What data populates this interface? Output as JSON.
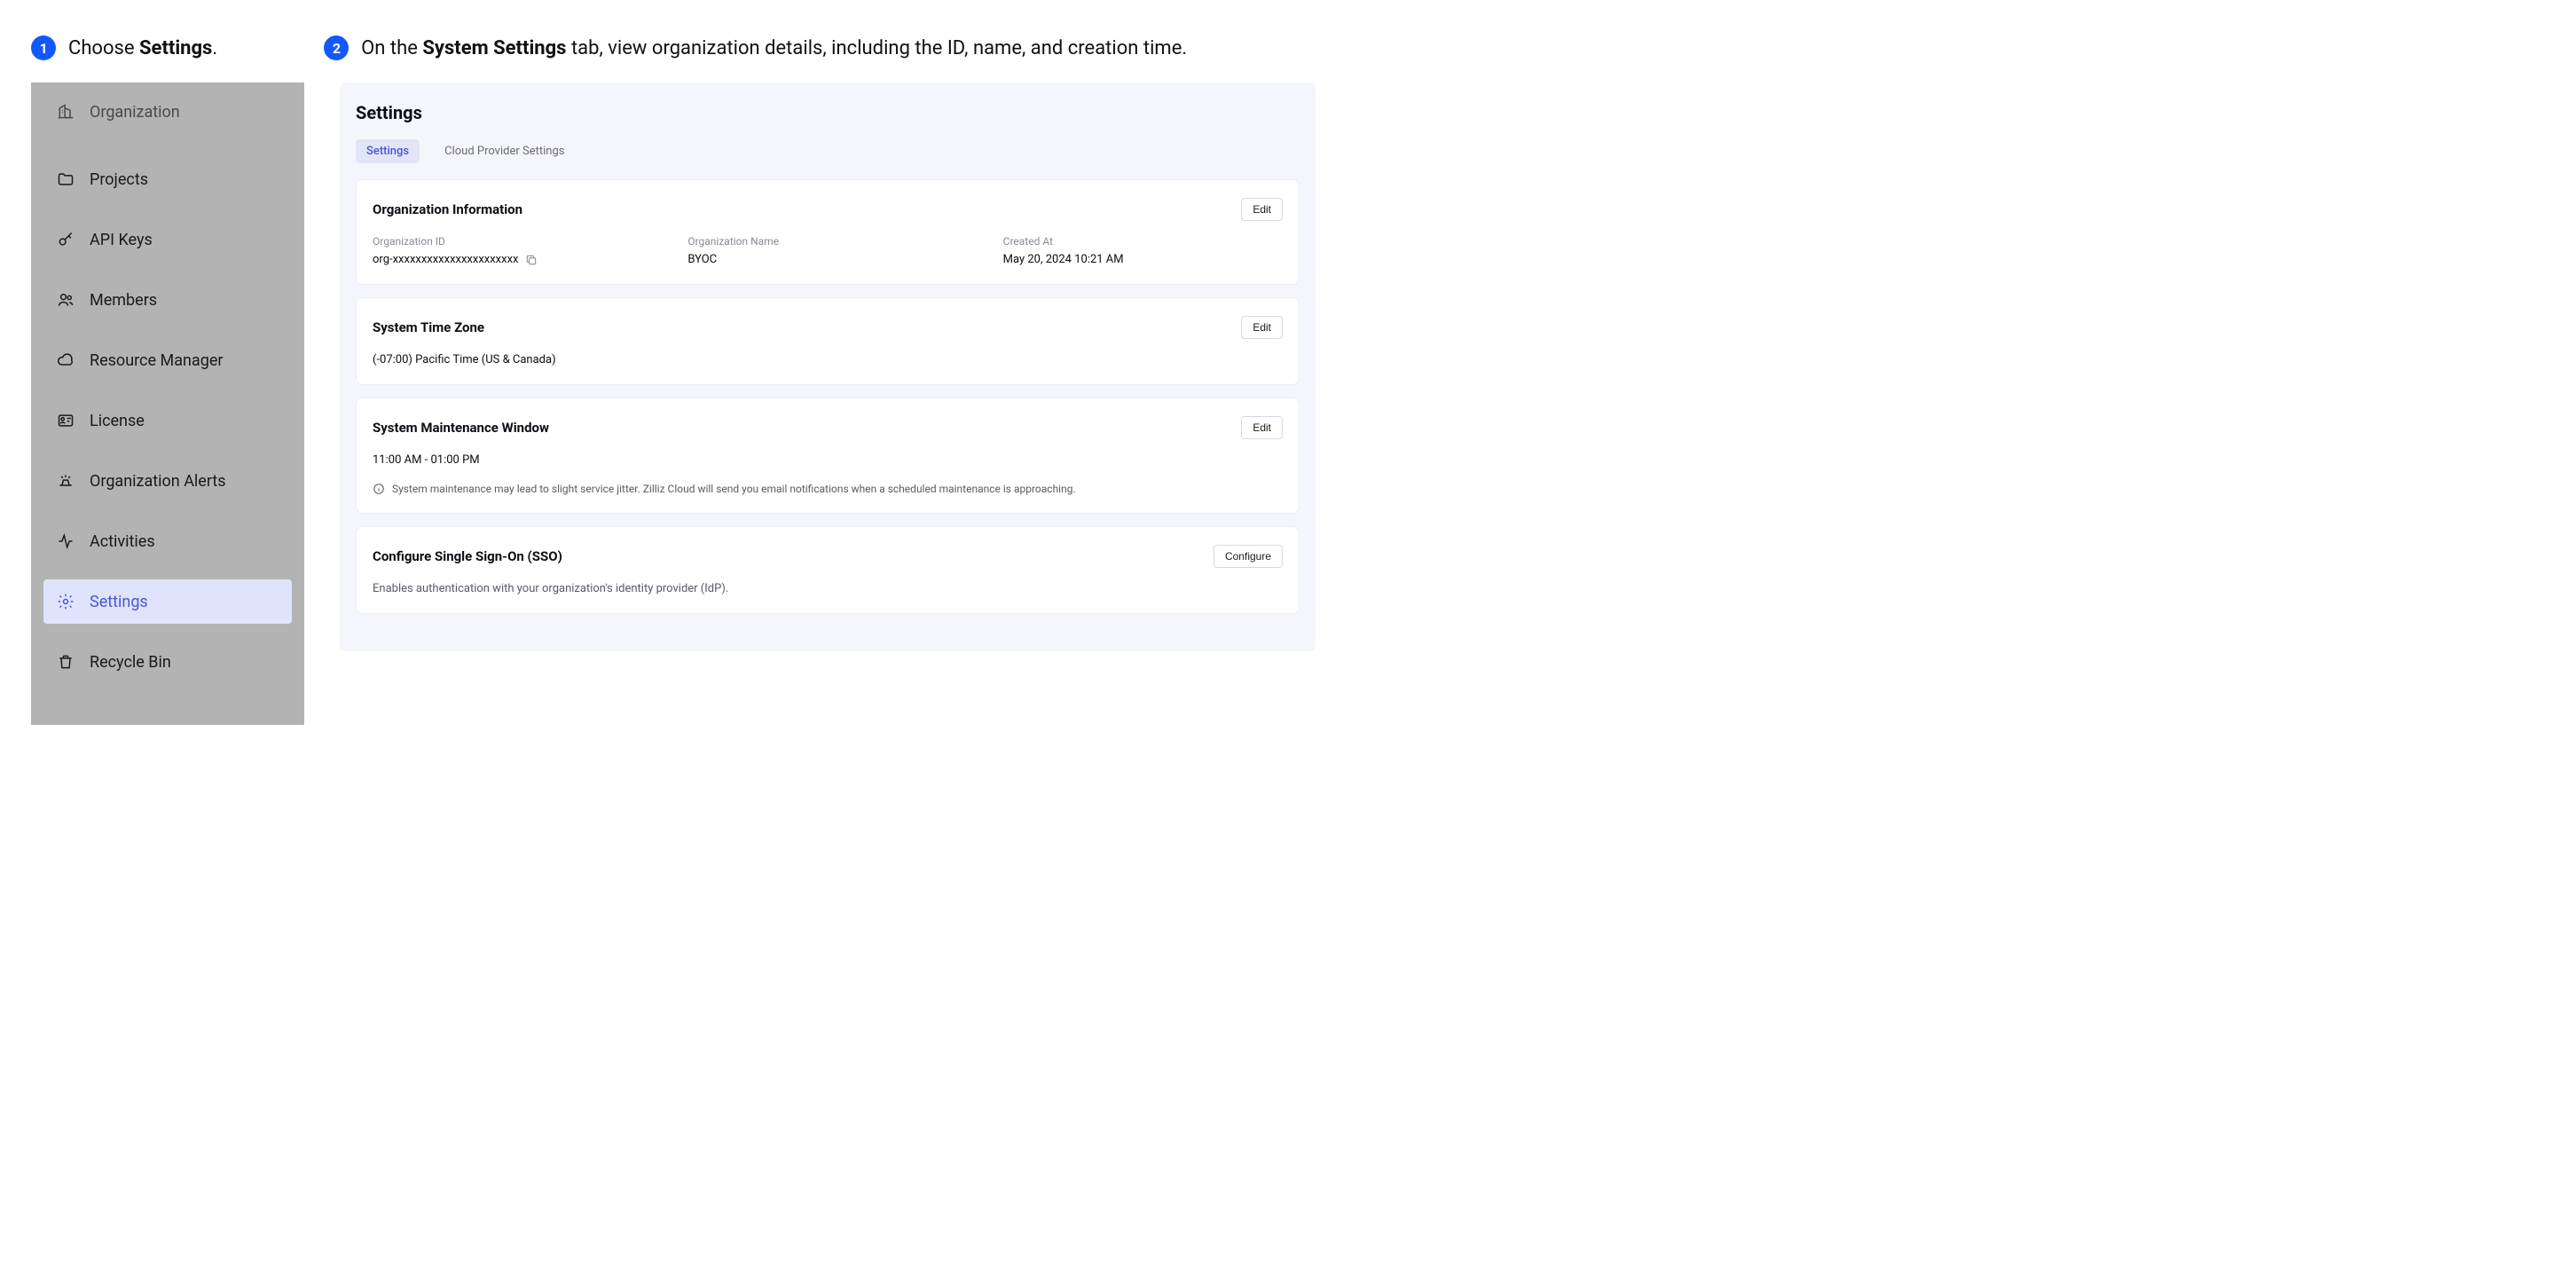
{
  "annotations": {
    "step1_prefix": "Choose ",
    "step1_bold": "Settings",
    "step1_suffix": ".",
    "step2_prefix": "On the ",
    "step2_bold": "System Settings",
    "step2_suffix": " tab, view organization details, including the ID, name, and creation time.",
    "badge1": "1",
    "badge2": "2"
  },
  "sidebar": {
    "organization": "Organization",
    "projects": "Projects",
    "api_keys": "API Keys",
    "members": "Members",
    "resource_manager": "Resource Manager",
    "license": "License",
    "alerts": "Organization Alerts",
    "activities": "Activities",
    "settings": "Settings",
    "recycle_bin": "Recycle Bin"
  },
  "main": {
    "title": "Settings",
    "tabs": {
      "settings": "Settings",
      "cloud_provider": "Cloud Provider Settings"
    },
    "org_info": {
      "title": "Organization Information",
      "edit": "Edit",
      "id_label": "Organization ID",
      "id_value": "org-xxxxxxxxxxxxxxxxxxxxxx",
      "name_label": "Organization Name",
      "name_value": "BYOC",
      "created_label": "Created At",
      "created_value": "May 20, 2024 10:21 AM"
    },
    "timezone": {
      "title": "System Time Zone",
      "edit": "Edit",
      "value": "(-07:00) Pacific Time (US & Canada)"
    },
    "maintenance": {
      "title": "System Maintenance Window",
      "edit": "Edit",
      "value": "11:00 AM - 01:00 PM",
      "hint": "System maintenance may lead to slight service jitter. Zilliz Cloud will send you email notifications when a scheduled maintenance is approaching."
    },
    "sso": {
      "title": "Configure Single Sign-On (SSO)",
      "configure": "Configure",
      "desc": "Enables authentication with your organization's identity provider (IdP)."
    }
  }
}
